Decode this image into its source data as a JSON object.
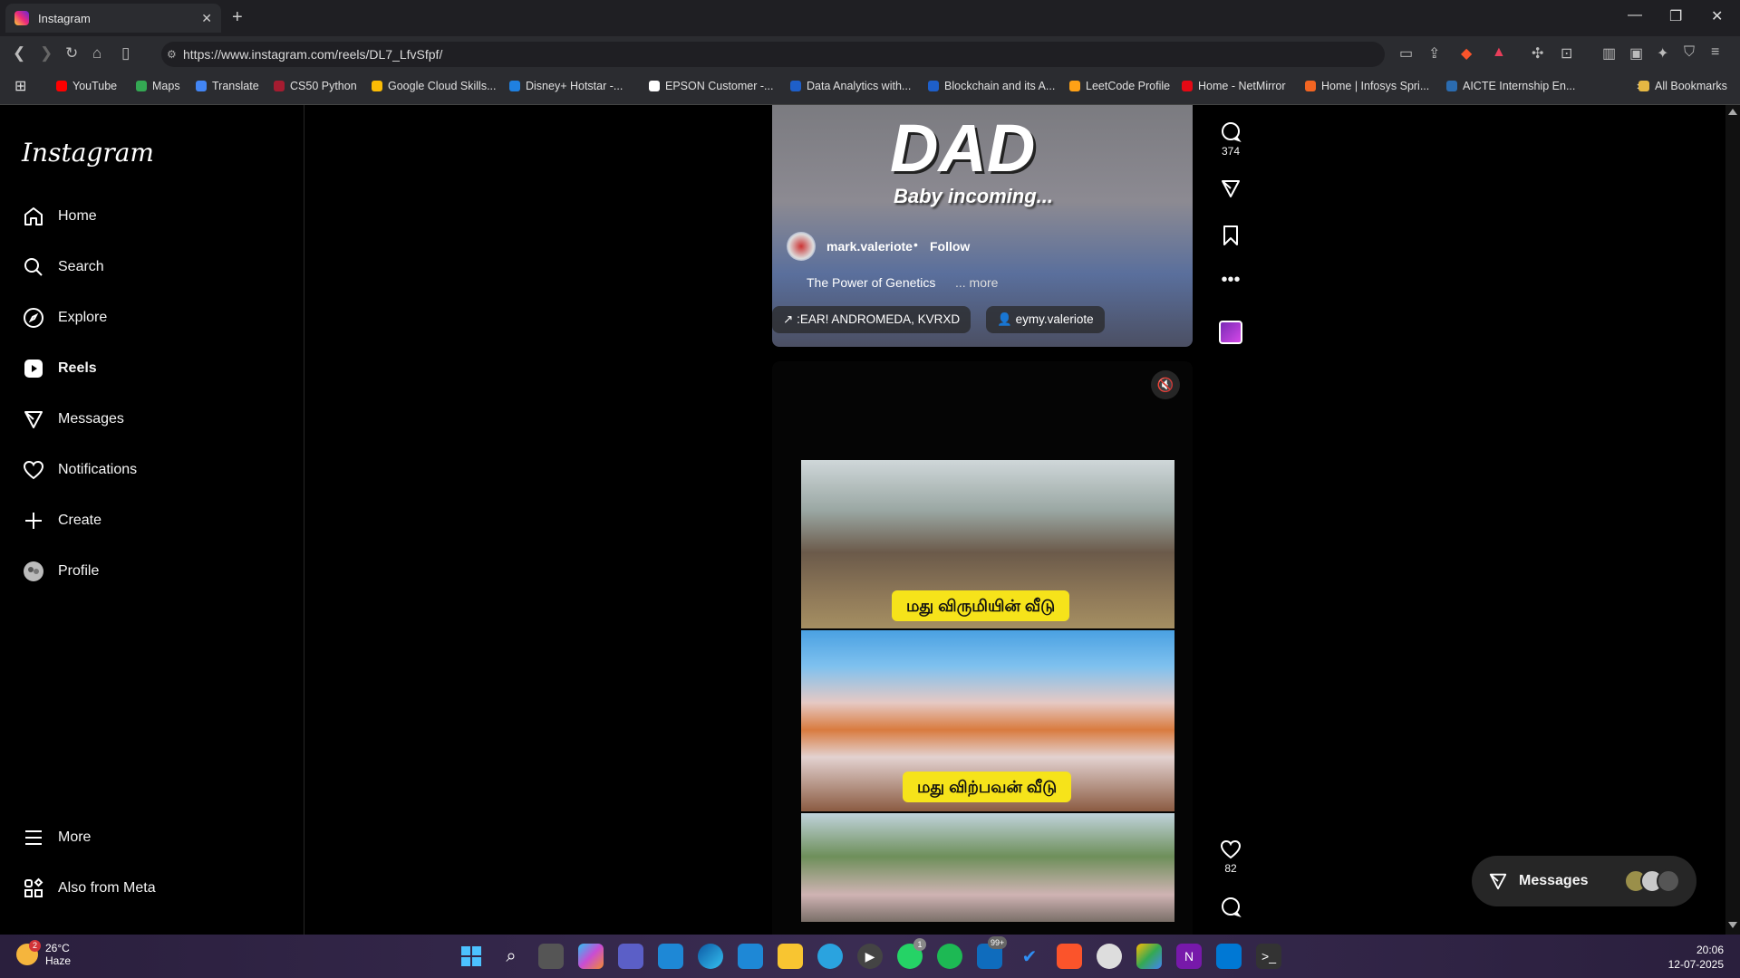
{
  "browser": {
    "tab_title": "Instagram",
    "url": "https://www.instagram.com/reels/DL7_LfvSfpf/",
    "bookmarks": [
      {
        "label": "YouTube",
        "color": "#ff0000"
      },
      {
        "label": "Maps",
        "color": "#34a853"
      },
      {
        "label": "Translate",
        "color": "#4285f4"
      },
      {
        "label": "CS50 Python",
        "color": "#a51c30"
      },
      {
        "label": "Google Cloud Skills...",
        "color": "#fbbc05"
      },
      {
        "label": "Disney+ Hotstar -...",
        "color": "#1f80e0"
      },
      {
        "label": "EPSON Customer -...",
        "color": "#ffffff"
      },
      {
        "label": "Data Analytics with...",
        "color": "#1e5fc9"
      },
      {
        "label": "Blockchain and its A...",
        "color": "#1e5fc9"
      },
      {
        "label": "LeetCode Profile",
        "color": "#ffa116"
      },
      {
        "label": "Home - NetMirror",
        "color": "#e50914"
      },
      {
        "label": "Home | Infosys Spri...",
        "color": "#f26522"
      },
      {
        "label": "AICTE Internship En...",
        "color": "#2b6cb0"
      }
    ],
    "all_bookmarks": "All Bookmarks"
  },
  "sidebar": {
    "logo": "Instagram",
    "items": [
      {
        "label": "Home",
        "icon": "home-icon"
      },
      {
        "label": "Search",
        "icon": "search-icon"
      },
      {
        "label": "Explore",
        "icon": "compass-icon"
      },
      {
        "label": "Reels",
        "icon": "reels-icon"
      },
      {
        "label": "Messages",
        "icon": "send-icon"
      },
      {
        "label": "Notifications",
        "icon": "heart-icon"
      },
      {
        "label": "Create",
        "icon": "plus-icon"
      },
      {
        "label": "Profile",
        "icon": "avatar-icon"
      }
    ],
    "bottom": [
      {
        "label": "More",
        "icon": "menu-icon"
      },
      {
        "label": "Also from Meta",
        "icon": "meta-icon"
      }
    ]
  },
  "reel1": {
    "overlay_title": "DAD",
    "overlay_subtitle": "Baby incoming...",
    "username": "mark.valeriote",
    "separator": "•",
    "follow": "Follow",
    "caption": "The Power of Genetics",
    "more": "... more",
    "audio": ":EAR!  ANDROMEDA, KVRXD",
    "tagged_user": "eymy.valeriote",
    "comments_count": "374"
  },
  "reel2": {
    "label_top": "மது விருமியின் வீடு",
    "label_bottom": "மது விற்பவன் வீடு",
    "likes_count": "82"
  },
  "messages_widget": {
    "label": "Messages"
  },
  "taskbar": {
    "temperature": "26°C",
    "weather": "Haze",
    "weather_badge": "2",
    "time": "20:06",
    "date": "12-07-2025",
    "whatsapp_badge": "1",
    "outlook_badge": "99+"
  }
}
